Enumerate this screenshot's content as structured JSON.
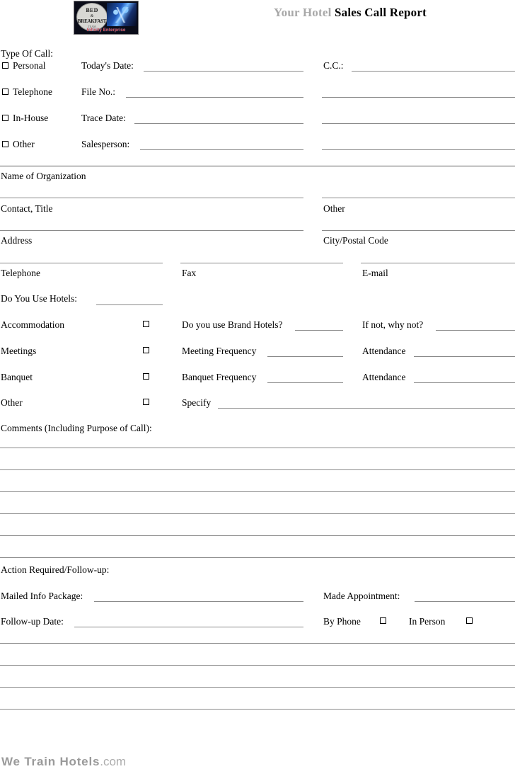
{
  "header": {
    "brand_prefix": "Your Hotel",
    "title": "Sales Call Report",
    "logo": {
      "seal_line1": "BED",
      "seal_line2": "&",
      "seal_line3": "BREAKFAST",
      "seal_line4": "TEAM",
      "tagline": "Infinity Enterprise"
    }
  },
  "type_of_call": {
    "heading": "Type Of Call:",
    "options": [
      {
        "label": "Personal"
      },
      {
        "label": "Telephone"
      },
      {
        "label": "In-House"
      },
      {
        "label": "Other"
      }
    ]
  },
  "call_details": [
    {
      "label": "Today's Date:"
    },
    {
      "label": "File No.:"
    },
    {
      "label": "Trace Date:"
    },
    {
      "label": "Salesperson:"
    }
  ],
  "cc": {
    "label": "C.C.:"
  },
  "organization": {
    "name_label": "Name of Organization",
    "contact_label": "Contact, Title",
    "other_label": "Other",
    "address_label": "Address",
    "city_label": "City/Postal Code",
    "telephone_label": "Telephone",
    "fax_label": "Fax",
    "email_label": "E-mail"
  },
  "hotel_usage": {
    "heading": "Do You Use Hotels:",
    "rows": [
      {
        "label": "Accommodation",
        "mid_label": "Do you use ",
        "mid_brand": "Brand Hotels",
        "mid_suffix": "?",
        "right_label": "If not, why not?"
      },
      {
        "label": "Meetings",
        "mid_label": "Meeting Frequency",
        "mid_brand": "",
        "mid_suffix": "",
        "right_label": "Attendance"
      },
      {
        "label": "Banquet",
        "mid_label": "Banquet Frequency",
        "mid_brand": "",
        "mid_suffix": "",
        "right_label": "Attendance"
      },
      {
        "label": "Other",
        "mid_label": "Specify",
        "mid_brand": "",
        "mid_suffix": "",
        "right_label": ""
      }
    ]
  },
  "comments": {
    "heading": "Comments (Including Purpose of Call):",
    "line_count": 6
  },
  "action": {
    "heading": "Action Required/Follow-up:",
    "mailed_label": "Mailed Info Package:",
    "appointment_label": "Made Appointment:",
    "followup_label": "Follow-up Date:",
    "by_phone_label": "By Phone",
    "in_person_label": "In Person",
    "trailing_line_count": 4
  },
  "footer": {
    "strong": "We Train Hotels",
    "light": ".com"
  },
  "colors": {
    "brand_gray": "#a8a8a8",
    "rule": "#8a8a8a",
    "footer_gray": "#9a9a9a"
  }
}
